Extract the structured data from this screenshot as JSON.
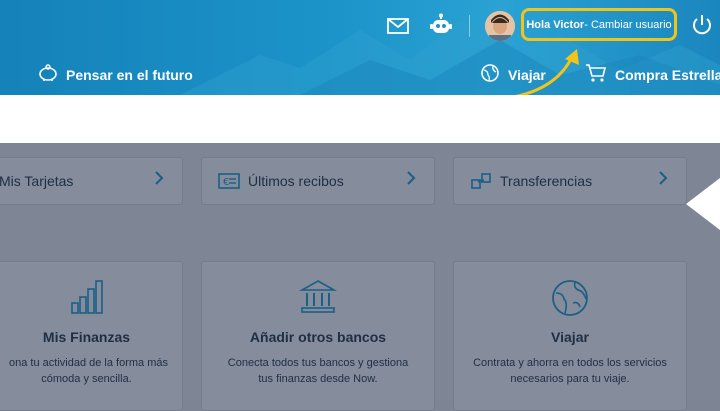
{
  "header": {
    "user_greeting": "Hola Victor",
    "user_switch": " - Cambiar usuario",
    "nav": {
      "future": "Pensar en el futuro",
      "travel": "Viajar",
      "shop": "Compra Estrella"
    }
  },
  "quick_cards": [
    {
      "label": "Mis Tarjetas",
      "icon": "card-icon"
    },
    {
      "label": "Últimos recibos",
      "icon": "receipt-icon"
    },
    {
      "label": "Transferencias",
      "icon": "transfer-icon"
    }
  ],
  "feature_cards": [
    {
      "title": "Mis Finanzas",
      "desc_line1": "ona tu actividad de la forma más",
      "desc_line2": "cómoda y sencilla.",
      "icon": "bar-chart-icon"
    },
    {
      "title": "Añadir otros bancos",
      "desc_line1": "Conecta todos tus bancos y gestiona",
      "desc_line2": "tus finanzas desde Now.",
      "icon": "bank-icon"
    },
    {
      "title": "Viajar",
      "desc_line1": "Contrata y ahorra en todos los servicios",
      "desc_line2": "necesarios para tu viaje.",
      "icon": "globe-icon"
    }
  ],
  "colors": {
    "header": "#1b93c9",
    "highlight": "#f0c419",
    "overlay": "#7e8595",
    "text_dark": "#1e2f45",
    "icon_blue": "#1a5f86"
  }
}
